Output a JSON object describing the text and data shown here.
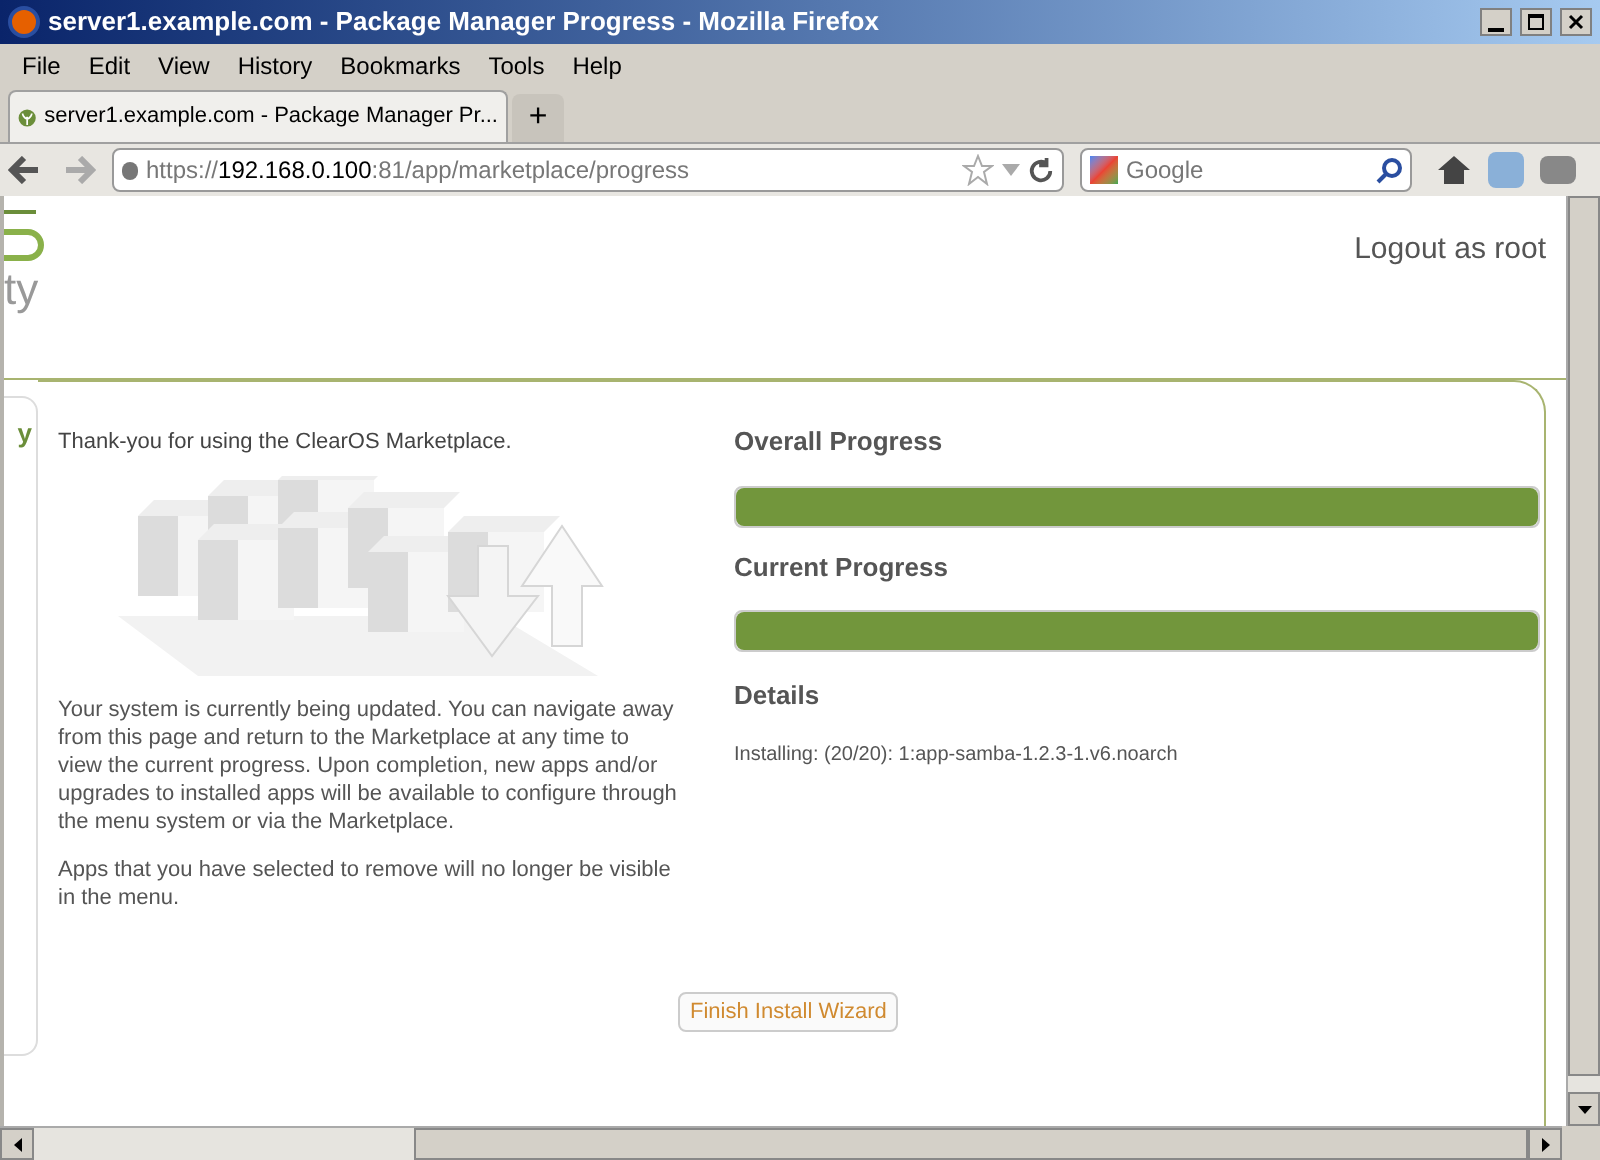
{
  "window": {
    "title": "server1.example.com - Package Manager Progress - Mozilla Firefox"
  },
  "menu": [
    "File",
    "Edit",
    "View",
    "History",
    "Bookmarks",
    "Tools",
    "Help"
  ],
  "tabs": [
    {
      "label": "server1.example.com - Package Manager Pr...",
      "selected": true
    }
  ],
  "new_tab": "+",
  "address": {
    "scheme": "https://",
    "host": "192.168.0.100",
    "rest": ":81/app/marketplace/progress"
  },
  "search": {
    "placeholder": "Google"
  },
  "header": {
    "logo_text": "ty",
    "logout": "Logout as root"
  },
  "side_tab": "y",
  "intro": "Thank-you for using the ClearOS Marketplace.",
  "paragraphs": [
    "Your system is currently being updated. You can navigate away from this page and return to the Marketplace at any time to view the current progress. Upon completion, new apps and/or upgrades to installed apps will be available to configure through the menu system or via the Marketplace.",
    "Apps that you have selected to remove will no longer be visible in the menu."
  ],
  "progress": [
    {
      "title": "Overall Progress",
      "level": 1
    },
    {
      "title": "Current Progress",
      "level": 1
    }
  ],
  "details": {
    "title": "Details",
    "text": "Installing: (20/20): 1:app-samba-1.2.3-1.v6.noarch"
  },
  "finish_button": "Finish Install Wizard"
}
